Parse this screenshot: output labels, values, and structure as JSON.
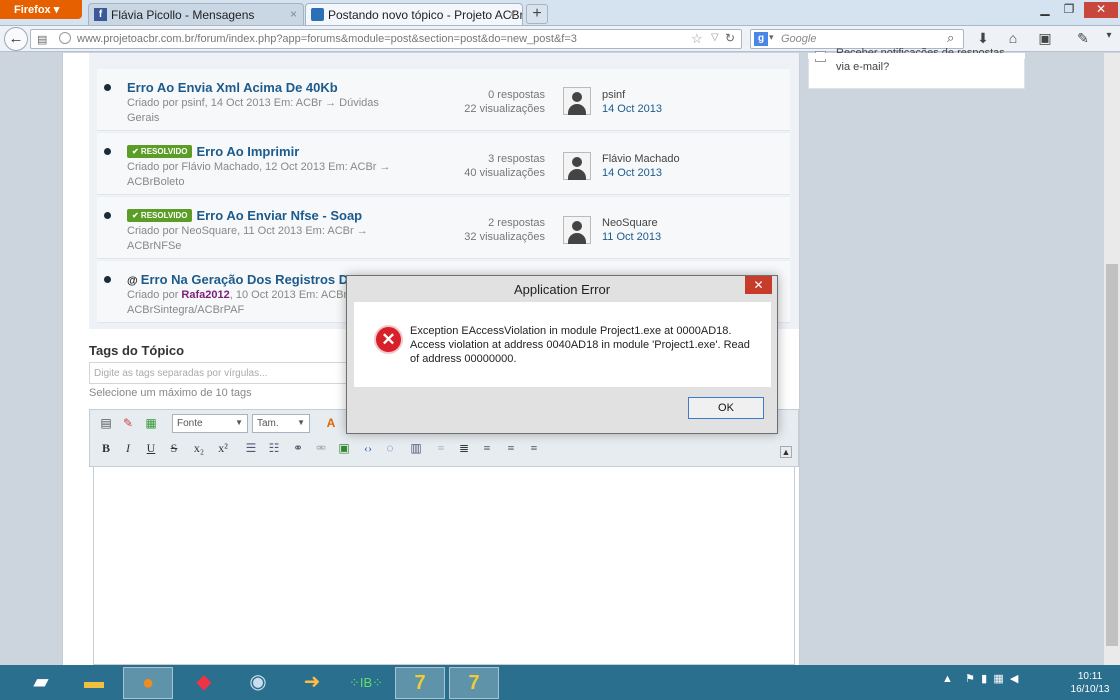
{
  "browser": {
    "app_button": "Firefox",
    "tabs": [
      {
        "label": "Flávia Picollo - Mensagens",
        "close": "×"
      },
      {
        "label": "Postando novo tópico - Projeto ACBr",
        "close": "×"
      }
    ],
    "new_tab": "+",
    "url": "www.projetoacbr.com.br/forum/index.php?app=forums&module=post&section=post&do=new_post&f=3",
    "search_placeholder": "Google"
  },
  "topics": [
    {
      "title": "Erro Ao Envia Xml Acima De 40Kb",
      "badge": "",
      "meta": "Criado por psinf, 14 Oct 2013 Em: ACBr → Dúvidas Gerais",
      "replies": "0 respostas",
      "views": "22 visualizações",
      "user": "psinf",
      "date": "14 Oct 2013"
    },
    {
      "title": "Erro Ao Imprimir",
      "badge": "✔ RESOLVIDO",
      "meta": "Criado por Flávio Machado, 12 Oct 2013 Em: ACBr → ACBrBoleto",
      "replies": "3 respostas",
      "views": "40 visualizações",
      "user": "Flávio Machado",
      "date": "14 Oct 2013"
    },
    {
      "title": "Erro Ao Enviar Nfse - Soap",
      "badge": "✔ RESOLVIDO",
      "meta": "Criado por NeoSquare, 11 Oct 2013 Em: ACBr → ACBrNFSe",
      "replies": "2 respostas",
      "views": "32 visualizações",
      "user": "NeoSquare",
      "date": "11 Oct 2013"
    },
    {
      "title": "Erro Na Geração Dos Registros D",
      "badge": "",
      "meta_prefix": "Criado por ",
      "meta_user": "Rafa2012",
      "meta_rest": ", 10 Oct 2013 Em: ACBr →",
      "meta_line2": "ACBrSintegra/ACBrPAF"
    }
  ],
  "tags": {
    "heading": "Tags do Tópico",
    "placeholder": "Digite as tags separadas por vírgulas...",
    "help": "Selecione um máximo de 10 tags"
  },
  "editor": {
    "font_select": "Fonte",
    "size_select": "Tam.",
    "format_buttons": [
      "B",
      "I",
      "U",
      "S",
      "x₂",
      "x²"
    ]
  },
  "sidebar": {
    "notify_line1": "Receber notificações de respostas",
    "notify_line2": "via e-mail?"
  },
  "dialog": {
    "title": "Application Error",
    "close": "✕",
    "line1": "Exception EAccessViolation in module Project1.exe at 0000AD18.",
    "line2": "Access violation at address 0040AD18 in module 'Project1.exe'. Read of address 00000000.",
    "ok": "OK",
    "icon": "error-icon"
  },
  "taskbar": {
    "time": "10:11",
    "date": "16/10/13"
  },
  "colors": {
    "link": "#1d5b8c",
    "resolved_badge": "#5b9d27",
    "taskbar": "#2a6f8e",
    "firefox_button": "#e66000",
    "dialog_close": "#c73b2b"
  }
}
